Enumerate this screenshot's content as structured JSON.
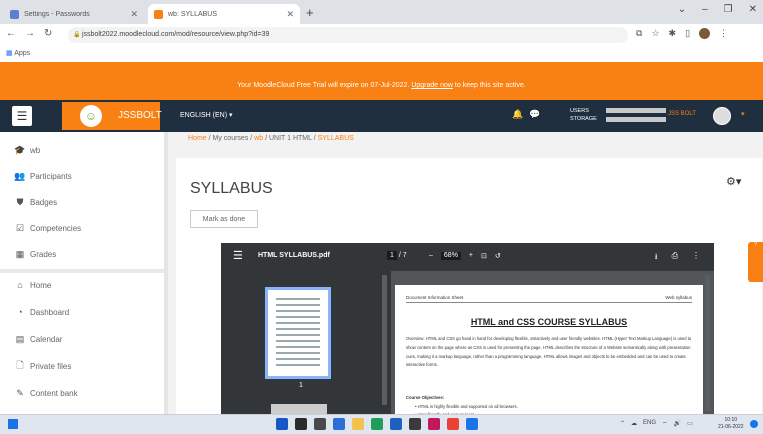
{
  "browser": {
    "tabs": [
      {
        "label": "Settings - Passwords",
        "active": false
      },
      {
        "label": "wb: SYLLABUS",
        "active": true
      }
    ],
    "new_tab": "+",
    "url": "jssbolt2022.moodlecloud.com/mod/resource/view.php?id=39",
    "bookmarks_apps": "Apps"
  },
  "trial_banner": {
    "message": "Your MoodleCloud Free Trial will expire on 07-Jul-2022. ",
    "link": "Upgrade now",
    "suffix": " to keep this site active."
  },
  "navbar": {
    "brand": "JSSBOLT",
    "language": "ENGLISH (EN) ▾",
    "users_label": "USERS",
    "storage_label": "STORAGE",
    "user_name": "JSS BOLT"
  },
  "sidebar": {
    "items": [
      {
        "label": "wb",
        "icon": "graduation-cap-icon"
      },
      {
        "label": "Participants",
        "icon": "users-icon"
      },
      {
        "label": "Badges",
        "icon": "shield-icon"
      },
      {
        "label": "Competencies",
        "icon": "check-square-icon"
      },
      {
        "label": "Grades",
        "icon": "table-icon"
      },
      {
        "label": "Home",
        "icon": "home-icon"
      },
      {
        "label": "Dashboard",
        "icon": "dashboard-icon"
      },
      {
        "label": "Calendar",
        "icon": "calendar-icon"
      },
      {
        "label": "Private files",
        "icon": "file-icon"
      },
      {
        "label": "Content bank",
        "icon": "pencil-icon"
      }
    ]
  },
  "breadcrumb": {
    "home": "Home",
    "my_courses": "My courses",
    "course": "wb",
    "section": "UNIT 1 HTML",
    "current": "SYLLABUS",
    "sep": " / "
  },
  "page": {
    "title": "SYLLABUS",
    "mark_done": "Mark as done"
  },
  "pdf": {
    "filename": "HTML SYLLABUS.pdf",
    "page_current": "1",
    "page_total": "/ 7",
    "zoom": "68%",
    "thumb_page_num": "1",
    "doc_header_left": "Document Information Sheet",
    "doc_header_right": "Web syllabus",
    "doc_title": "HTML and CSS COURSE SYLLABUS",
    "doc_paragraph": "Overview: HTML and CSS go hand in hand for developing flexible, attractively and user friendly websites. HTML (Hyper Text Markup Language) is used to show content on the page where as CSS is used for presenting the page. HTML describes the structure of a Website semantically along with presentation cues, making it a markup language, rather than a programming language. HTML allows images and objects to be embedded and can be used to create interactive forms.",
    "doc_objectives": "Course Objectives:",
    "doc_bullet1": "•  HTML is highly flexible and supported on all browsers.",
    "doc_bullet2": "•  User friendly and easy to learn."
  },
  "taskbar": {
    "tray_text": "ENG",
    "time": "10:10",
    "date": "21-06-2022"
  }
}
